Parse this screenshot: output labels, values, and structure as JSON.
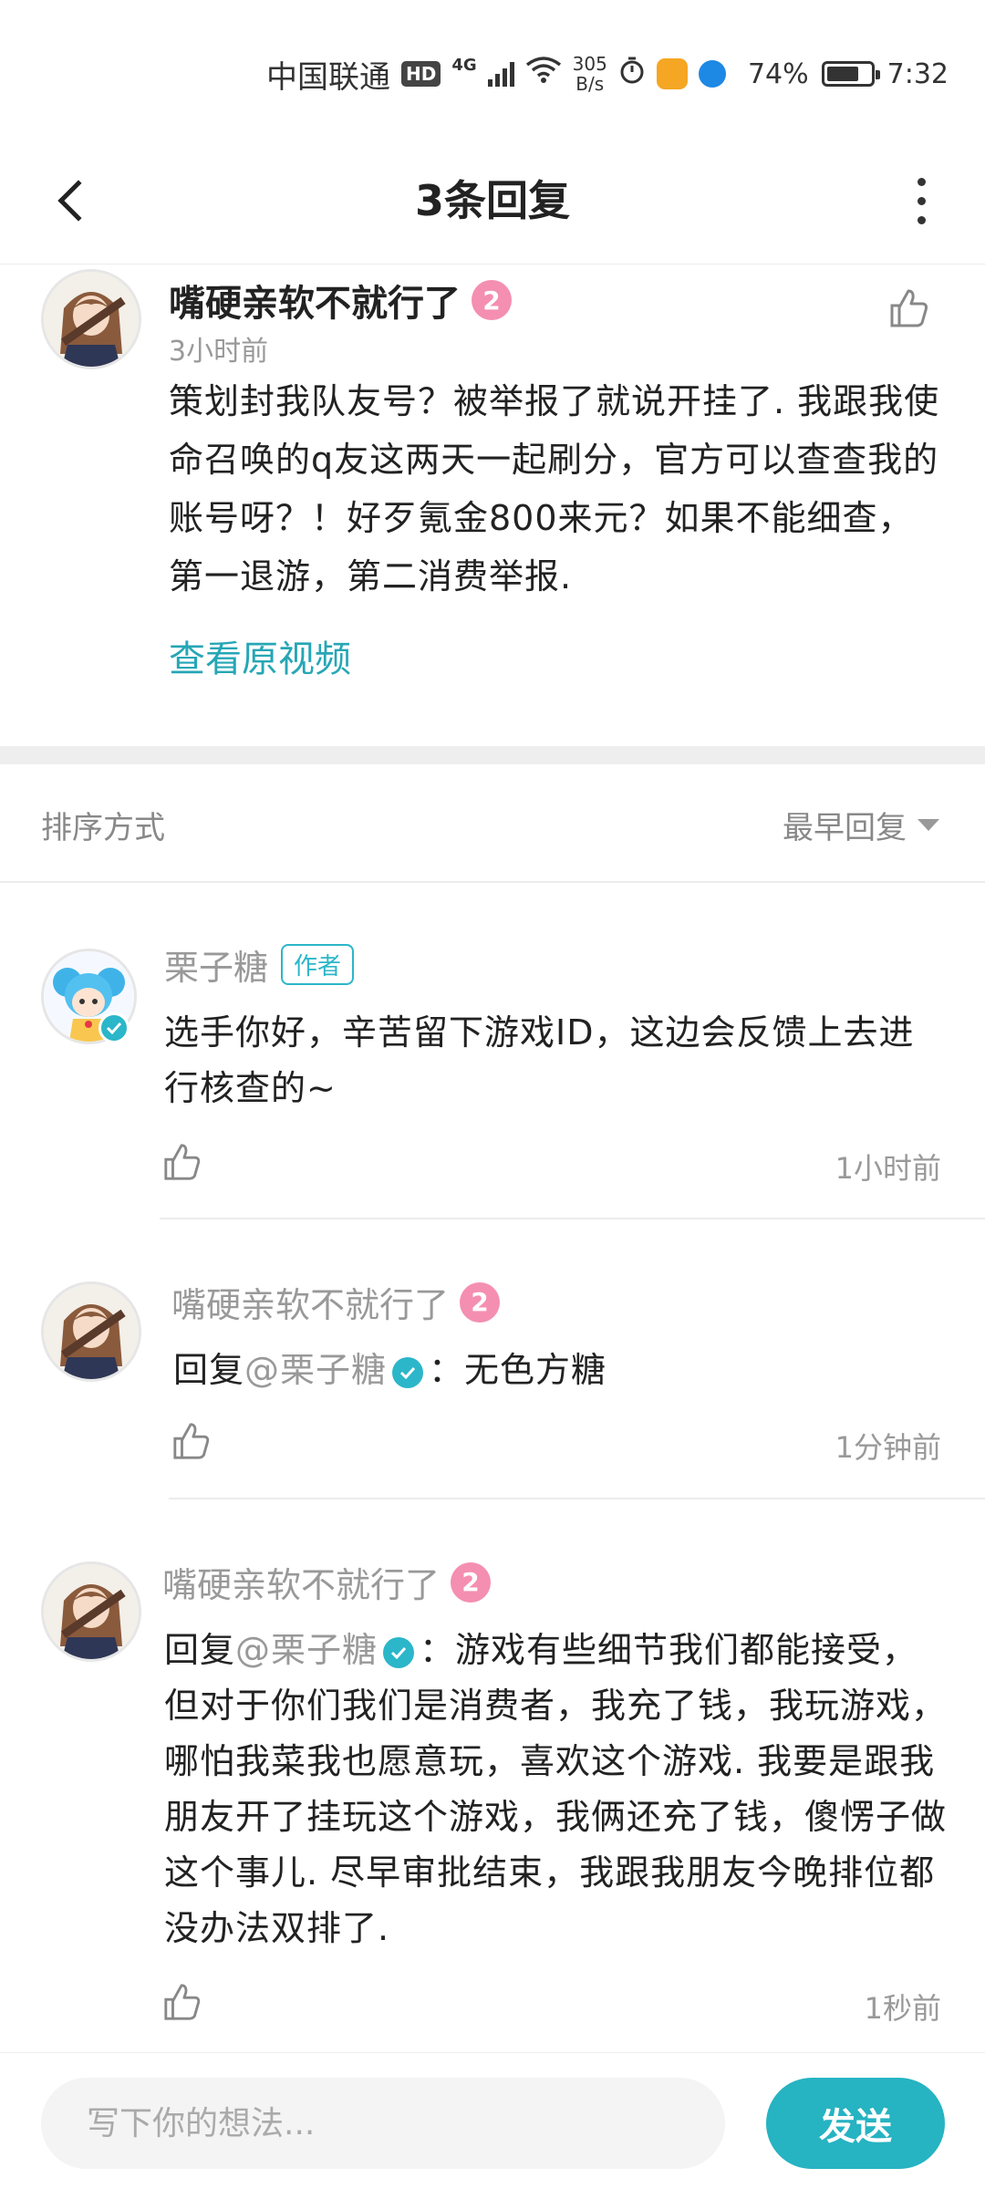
{
  "status_bar": {
    "carrier": "中国联通",
    "hd": "HD",
    "network": "4G",
    "speed_value": "305",
    "speed_unit": "B/s",
    "battery_percent": "74%",
    "time": "7:32"
  },
  "header": {
    "title": "3条回复"
  },
  "main_comment": {
    "author": "嘴硬亲软不就行了",
    "level": "2",
    "time": "3小时前",
    "content": "策划封我队友号？被举报了就说开挂了. 我跟我使命召唤的q友这两天一起刷分，官方可以查查我的账号呀？！好歹氪金800来元？如果不能细查，第一退游，第二消费举报.",
    "view_video": "查看原视频"
  },
  "sort": {
    "label": "排序方式",
    "selected": "最早回复"
  },
  "replies": [
    {
      "author": "栗子糖",
      "tag": "作者",
      "content": "选手你好，辛苦留下游戏ID，这边会反馈上去进行核查的~",
      "time": "1小时前"
    },
    {
      "author": "嘴硬亲软不就行了",
      "level": "2",
      "reply_prefix": "回复",
      "mention": "@栗子糖",
      "content": "：无色方糖",
      "time": "1分钟前"
    },
    {
      "author": "嘴硬亲软不就行了",
      "level": "2",
      "reply_prefix": "回复",
      "mention": "@栗子糖",
      "content": "：游戏有些细节我们都能接受，但对于你们我们是消费者，我充了钱，我玩游戏，哪怕我菜我也愿意玩，喜欢这个游戏. 我要是跟我朋友开了挂玩这个游戏，我俩还充了钱，傻愣子做这个事儿. 尽早审批结束，我跟我朋友今晚排位都没办法双排了.",
      "time": "1秒前"
    }
  ],
  "input": {
    "placeholder": "写下你的想法..."
  },
  "send_label": "发送",
  "colors": {
    "accent": "#26b3c2",
    "level_badge": "#f48fb1",
    "muted_text": "#999999"
  },
  "icons": [
    "back-icon",
    "more-icon",
    "thumbs-up-icon",
    "verified-icon",
    "caret-down-icon"
  ]
}
